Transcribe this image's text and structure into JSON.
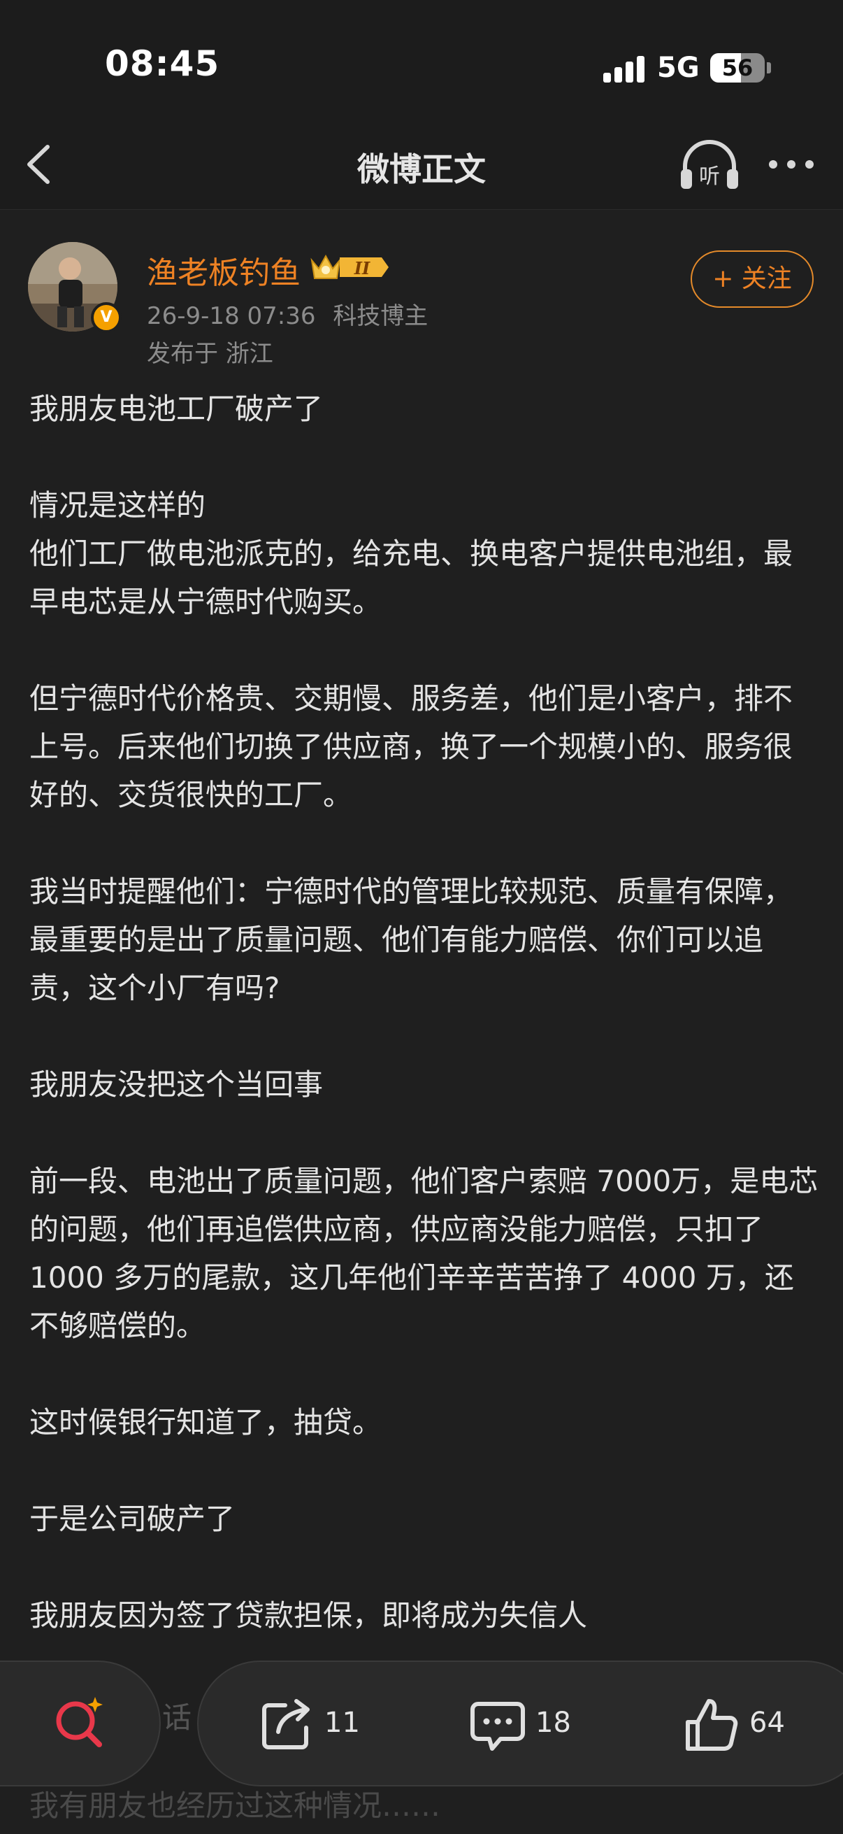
{
  "status_bar": {
    "time": "08:45",
    "network": "5G",
    "battery": "56",
    "battery_level": 0.56
  },
  "nav": {
    "title": "微博正文",
    "listen_label": "听"
  },
  "author": {
    "name": "渔老板钓鱼",
    "level_badge": "II",
    "verified_mark": "V",
    "post_time": "26-9-18 07:36",
    "category": "科技博主",
    "location": "发布于 浙江",
    "follow_label": "+ 关注"
  },
  "post": {
    "paragraphs": [
      "我朋友电池工厂破产了",
      "情况是这样的\n他们工厂做电池派克的，给充电、换电客户提供电池组，最早电芯是从宁德时代购买。",
      "但宁德时代价格贵、交期慢、服务差，他们是小客户，排不上号。后来他们切换了供应商，换了一个规模小的、服务很好的、交货很快的工厂。",
      "我当时提醒他们：宁德时代的管理比较规范、质量有保障，最重要的是出了质量问题、他们有能力赔偿、你们可以追责，这个小厂有吗?",
      "我朋友没把这个当回事",
      "前一段、电池出了质量问题，他们客户索赔 7000万，是电芯的问题，他们再追偿供应商，供应商没能力赔偿，只扣了 1000 多万的尾款，这几年他们辛辛苦苦挣了 4000 万，还不够赔偿的。",
      "这时候银行知道了，抽贷。",
      "于是公司破产了",
      "我朋友因为签了贷款担保，即将成为失信人"
    ],
    "faded_line": "我有朋友也经历过这种情况……"
  },
  "bottom_bar": {
    "comment_hint": "话",
    "repost_count": "11",
    "comment_count": "18",
    "like_count": "64"
  },
  "colors": {
    "accent": "#ee8224",
    "background": "#1f1f1f",
    "text": "#e4e4e4",
    "meta": "#8c8c8c"
  }
}
